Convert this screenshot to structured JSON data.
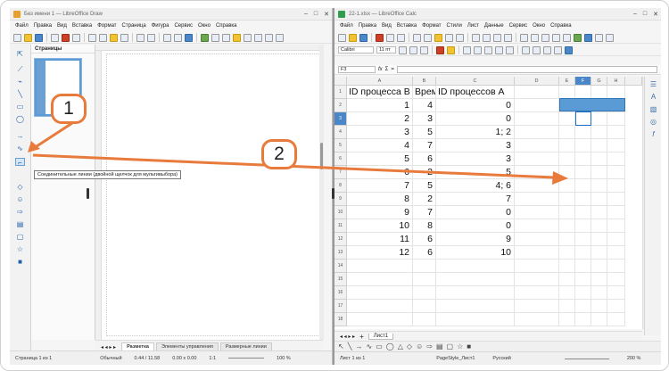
{
  "draw": {
    "title": "Без имени 1 — LibreOffice Draw",
    "menu": [
      "Файл",
      "Правка",
      "Вид",
      "Вставка",
      "Формат",
      "Страница",
      "Фигура",
      "Сервис",
      "Окно",
      "Справка"
    ],
    "pages_panel_title": "Страницы",
    "tooltip": "Соединительные линии (двойной щелчок для мультивыбора)",
    "tabs": [
      "Разметка",
      "Элементы управления",
      "Размерные линии"
    ],
    "status": {
      "page": "Страница 1 из 1",
      "mode": "Обычный",
      "pos": "0.44 / 11.58",
      "size": "0.00 x 0.00",
      "ratio": "1:1",
      "zoom": "100 %"
    }
  },
  "calc": {
    "title": "22-1.xlsx — LibreOffice Calc",
    "menu": [
      "Файл",
      "Правка",
      "Вид",
      "Вставка",
      "Формат",
      "Стили",
      "Лист",
      "Данные",
      "Сервис",
      "Окно",
      "Справка"
    ],
    "font_name": "Calibri",
    "font_size": "11 пт",
    "name_box": "F3",
    "formula_icons": [
      "fx",
      "Σ",
      "="
    ],
    "columns": [
      "A",
      "B",
      "C",
      "D",
      "E",
      "F",
      "G",
      "H"
    ],
    "rows": [
      "1",
      "2",
      "3",
      "4",
      "5",
      "6",
      "7",
      "8",
      "9",
      "10",
      "11",
      "12",
      "13",
      "14",
      "15",
      "16",
      "17",
      "18"
    ],
    "header_row": {
      "A": "ID процесса В",
      "B": "Время",
      "C": "ID процессов А"
    },
    "data": [
      [
        "1",
        "4",
        "0"
      ],
      [
        "2",
        "3",
        "0"
      ],
      [
        "3",
        "5",
        "1; 2"
      ],
      [
        "4",
        "7",
        "3"
      ],
      [
        "5",
        "6",
        "3"
      ],
      [
        "6",
        "2",
        "5"
      ],
      [
        "7",
        "5",
        "4; 6"
      ],
      [
        "8",
        "2",
        "7"
      ],
      [
        "9",
        "7",
        "0"
      ],
      [
        "10",
        "8",
        "0"
      ],
      [
        "11",
        "6",
        "9"
      ],
      [
        "12",
        "6",
        "10"
      ]
    ],
    "sheet_tab": "Лист1",
    "status": {
      "sheet": "Лист 1 из 1",
      "style": "PageStyle_Лист1",
      "lang": "Русский",
      "zoom": "200 %"
    }
  },
  "annotations": {
    "badge1": "1",
    "badge2": "2",
    "color": "#e87b3c"
  }
}
